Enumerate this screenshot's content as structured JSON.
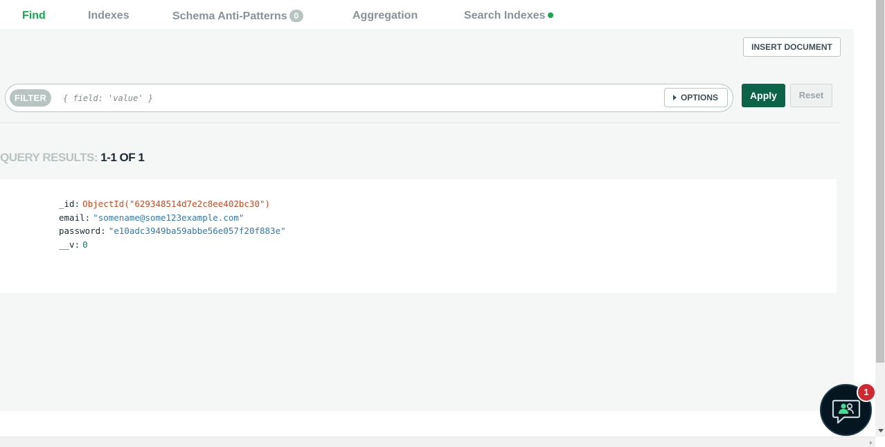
{
  "tabs": [
    {
      "label": "Find",
      "active": true
    },
    {
      "label": "Indexes"
    },
    {
      "label": "Schema Anti-Patterns",
      "count": "0"
    },
    {
      "label": "Aggregation"
    },
    {
      "label": "Search Indexes",
      "status_dot": true
    }
  ],
  "toolbar": {
    "insert_document_label": "INSERT DOCUMENT"
  },
  "filter": {
    "label": "FILTER",
    "placeholder": "{ field: 'value' }",
    "value": "",
    "options_label": "OPTIONS",
    "apply_label": "Apply",
    "reset_label": "Reset"
  },
  "results": {
    "label": "QUERY RESULTS:",
    "count_text": "1-1 OF 1"
  },
  "document": {
    "fields": [
      {
        "key": "_id",
        "value": "ObjectId(\"629348514d7e2c8ee402bc30\")",
        "type": "objectid"
      },
      {
        "key": "email",
        "value": "\"somename@some123example.com\"",
        "type": "string"
      },
      {
        "key": "password",
        "value": "\"e10adc3949ba59abbe56e057f20f883e\"",
        "type": "string"
      },
      {
        "key": "__v",
        "value": "0",
        "type": "number"
      }
    ]
  },
  "chat": {
    "icon": "chat-people-icon",
    "badge_count": "1"
  },
  "colors": {
    "accent_green": "#13aa52",
    "apply_bg": "#0b6348",
    "objectid": "#d4471b",
    "string": "#2e7ab8",
    "number": "#167a5a",
    "badge": "#d0282e"
  }
}
